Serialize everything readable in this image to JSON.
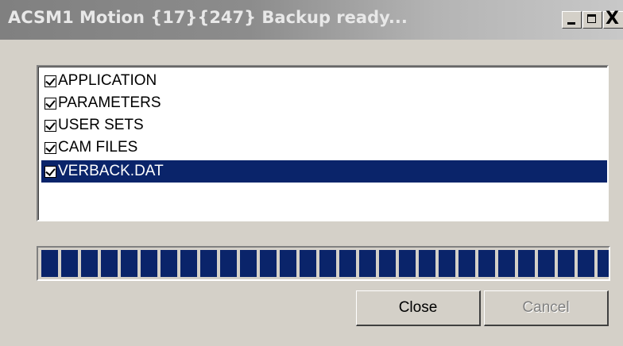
{
  "window": {
    "title": "ACSM1 Motion {17}{247} Backup ready..."
  },
  "titlebar_buttons": {
    "minimize_icon": "minimize-icon",
    "maximize_icon": "maximize-icon",
    "close_icon": "close-icon",
    "close_glyph": "X"
  },
  "items": [
    {
      "label": "APPLICATION",
      "checked": true,
      "selected": false
    },
    {
      "label": "PARAMETERS",
      "checked": true,
      "selected": false
    },
    {
      "label": "USER SETS",
      "checked": true,
      "selected": false
    },
    {
      "label": "CAM FILES",
      "checked": true,
      "selected": false
    },
    {
      "label": "VERBACK.DAT",
      "checked": true,
      "selected": true
    }
  ],
  "progress": {
    "value_percent": 100
  },
  "buttons": {
    "close_label": "Close",
    "cancel_label": "Cancel",
    "cancel_enabled": false
  },
  "colors": {
    "face": "#d4d0c8",
    "selection": "#0a246a",
    "progress_chunk": "#0a246a",
    "disabled_text": "#808080"
  }
}
